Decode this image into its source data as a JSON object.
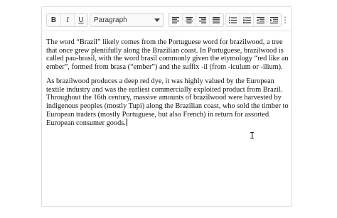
{
  "toolbar": {
    "bold_label": "B",
    "italic_label": "I",
    "underline_label": "U",
    "block_format": "Paragraph",
    "more_label": "⋮"
  },
  "content": {
    "paragraphs": [
      "The word “Brazil” likely comes from the Portuguese word for brazilwood, a tree that once grew plentifully along the Brazilian coast. In Portuguese, brazilwood is called pau-brasil, with the word brasil commonly given the etymology “red like an ember”, formed from brasa (“ember”) and the suffix -il (from -iculum or -ilium).",
      "As brazilwood produces a deep red dye, it was highly valued by the European textile industry and was the earliest commercially exploited product from Brazil. Throughout the 16th century, massive amounts of brazilwood were harvested by indigenous peoples (mostly Tupi) along the Brazilian coast, who sold the timber to European traders (mostly Portuguese, but also French) in return for assorted European consumer goods."
    ]
  },
  "icons": [
    "align-left-icon",
    "align-center-icon",
    "align-right-icon",
    "align-justify-icon",
    "bullet-list-icon",
    "numbered-list-icon",
    "outdent-icon",
    "indent-icon",
    "more-options-icon"
  ]
}
